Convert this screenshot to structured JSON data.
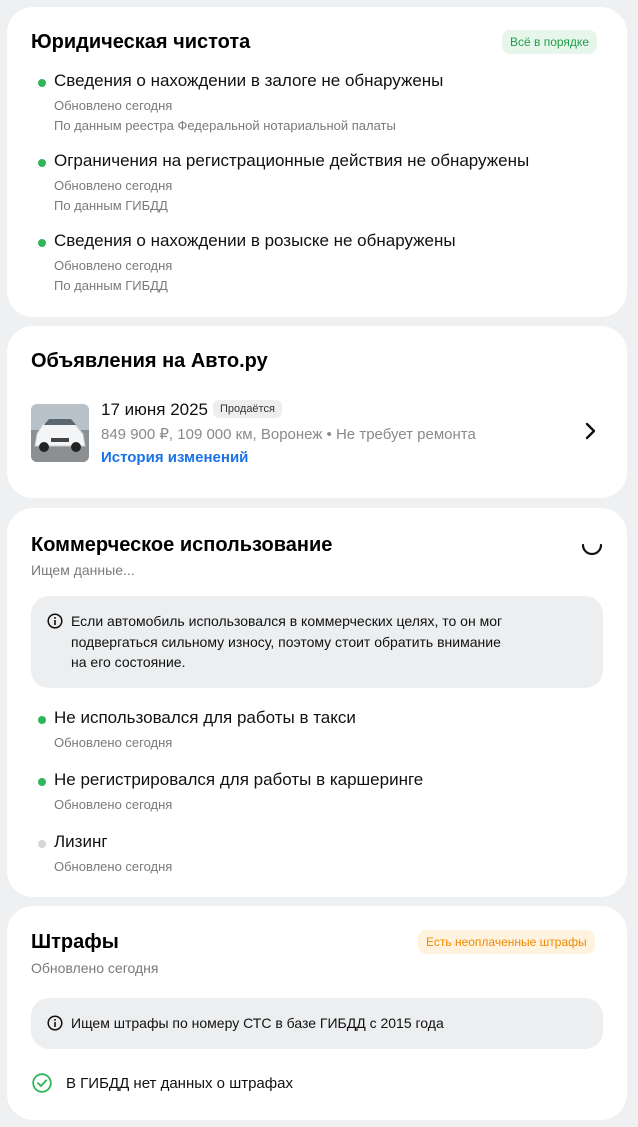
{
  "legal": {
    "title": "Юридическая чистота",
    "badge": "Всё в порядке",
    "items": [
      {
        "title": "Сведения о нахождении в залоге не обнаружены",
        "updated": "Обновлено сегодня",
        "source": "По данным реестра Федеральной нотариальной палаты"
      },
      {
        "title": "Ограничения на регистрационные действия не обнаружены",
        "updated": "Обновлено сегодня",
        "source": "По данным ГИБДД"
      },
      {
        "title": "Сведения о нахождении в розыске не обнаружены",
        "updated": "Обновлено сегодня",
        "source": "По данным ГИБДД"
      }
    ]
  },
  "ads": {
    "title": "Объявления на Авто.ру",
    "listing": {
      "date": "17 июня 2025",
      "status": "Продаётся",
      "details": "849 900 ₽, 109 000 км, Воронеж • Не требует ремонта",
      "history_link": "История изменений"
    }
  },
  "commercial": {
    "title": "Коммерческое использование",
    "subtitle": "Ищем данные...",
    "info_lines": [
      "Если автомобиль использовался в коммерческих целях, то он мог",
      "подвергаться сильному износу, поэтому стоит обратить внимание",
      "на его состояние."
    ],
    "items": [
      {
        "title": "Не использовался для работы в такси",
        "updated": "Обновлено сегодня",
        "status": "ok"
      },
      {
        "title": "Не регистрировался для работы в каршеринге",
        "updated": "Обновлено сегодня",
        "status": "ok"
      },
      {
        "title": "Лизинг",
        "updated": "Обновлено сегодня",
        "status": "pending"
      }
    ]
  },
  "fines": {
    "title": "Штрафы",
    "badge": "Есть неоплаченные штрафы",
    "subtitle": "Обновлено сегодня",
    "info": "Ищем штрафы по номеру СТС в базе ГИБДД с 2015 года",
    "result": "В ГИБДД нет данных о штрафах"
  },
  "colors": {
    "ok_green": "#2fb55a",
    "pending_gray": "#d6d6d6",
    "link_blue": "#1a73e8",
    "badge_green_bg": "#e6f6ea",
    "badge_green_text": "#1f9d4a",
    "badge_orange_bg": "#fff3e0",
    "badge_orange_text": "#f08a00"
  }
}
